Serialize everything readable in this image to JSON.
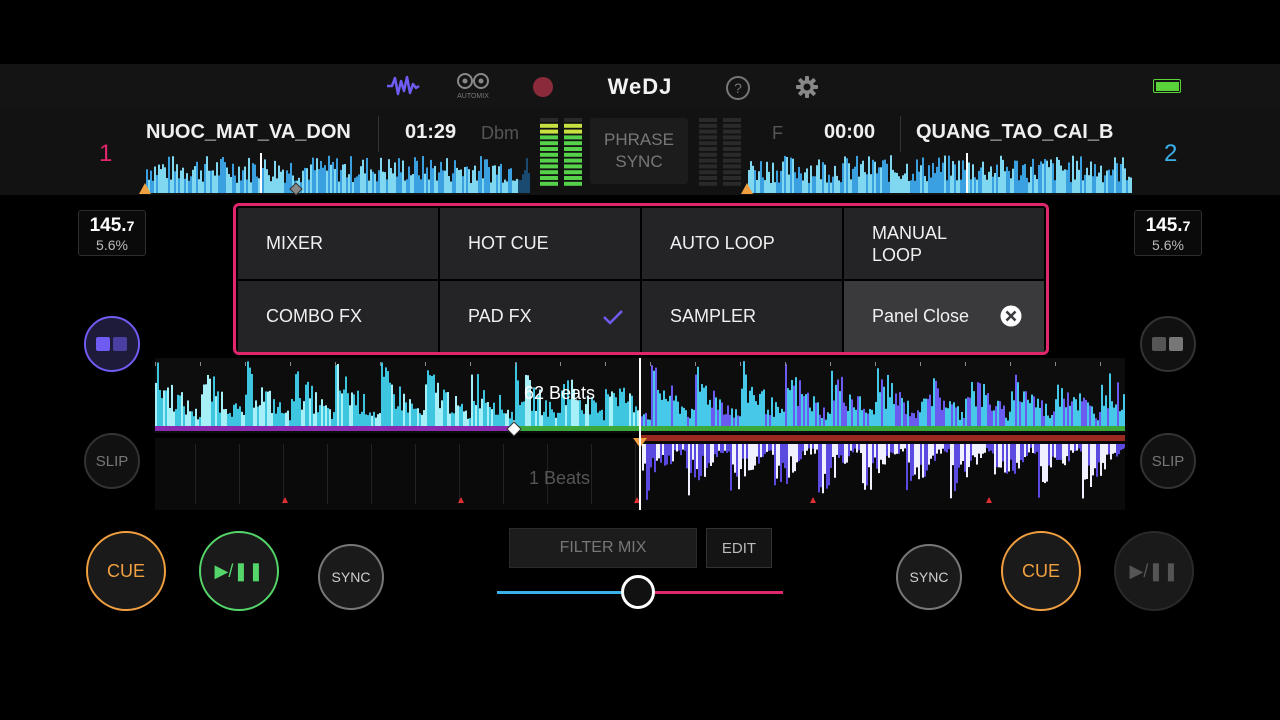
{
  "app": {
    "brand": "WeDJ"
  },
  "topbar": {
    "icons": [
      "waveform-icon",
      "automix-icon",
      "record-icon",
      "help-icon",
      "settings-icon",
      "battery-icon"
    ],
    "automix_label": "AUTOMIX",
    "colors": {
      "waveform": "#6f5cf2",
      "record": "#8a2a3a",
      "battery": "#5ad23a"
    }
  },
  "deck1": {
    "number": "1",
    "title": "NUOC_MAT_VA_DON",
    "time": "01:29",
    "key": "Dbm",
    "bpm_int": "145.",
    "bpm_dec": "7",
    "pitch": "5.6%",
    "cue_label": "CUE",
    "play_label": "▶/❚❚",
    "sync_label": "SYNC",
    "slip_label": "SLIP",
    "beats_label": "62 Beats",
    "color": "#e0266d"
  },
  "deck2": {
    "number": "2",
    "title": "QUANG_TAO_CAI_B",
    "time": "00:00",
    "key": "F",
    "bpm_int": "145.",
    "bpm_dec": "7",
    "pitch": "5.6%",
    "cue_label": "CUE",
    "play_label": "▶/❚❚",
    "sync_label": "SYNC",
    "slip_label": "SLIP",
    "beats_label": "1 Beats",
    "color": "#3ab0e8"
  },
  "phrase_sync": {
    "line1": "PHRASE",
    "line2": "SYNC"
  },
  "panel": {
    "row1": [
      "MIXER",
      "HOT CUE",
      "AUTO LOOP",
      "MANUAL LOOP"
    ],
    "row1_manual": [
      "MANUAL",
      "LOOP"
    ],
    "row2": [
      "COMBO FX",
      "PAD FX",
      "SAMPLER",
      "Panel Close"
    ],
    "selected": "PAD FX",
    "accent": "#e0266d",
    "check_color": "#6f5cf2"
  },
  "mixer": {
    "filter_label": "FILTER MIX",
    "edit_label": "EDIT",
    "crossfader": 0.5,
    "left_color": "#3ab0e8",
    "right_color": "#e0266d"
  }
}
